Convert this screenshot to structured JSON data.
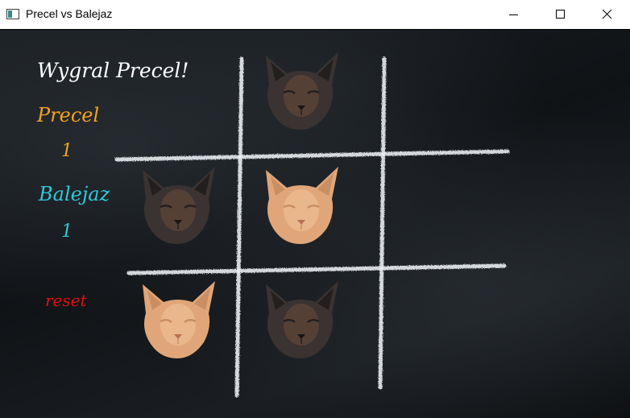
{
  "window": {
    "title": "Precel vs Balejaz",
    "controls": [
      "minimize-icon",
      "maximize-icon",
      "close-icon"
    ]
  },
  "status": {
    "message": "Wygral Precel!"
  },
  "players": [
    {
      "name": "Precel",
      "score": "1",
      "color": "#f5a21d",
      "piece": "dark-tortoiseshell-cat-icon"
    },
    {
      "name": "Balejaz",
      "score": "1",
      "color": "#2ec8d8",
      "piece": "ginger-cat-icon"
    }
  ],
  "reset": {
    "label": "reset",
    "color": "#e01010"
  },
  "board": {
    "cells": [
      [
        "",
        "Precel",
        ""
      ],
      [
        "Precel",
        "Balejaz",
        ""
      ],
      [
        "Balejaz",
        "Precel",
        ""
      ]
    ]
  },
  "colors": {
    "chalk": "#e9ecef",
    "dark_cat": "#3a3332",
    "ginger_cat": "#e0a679"
  }
}
